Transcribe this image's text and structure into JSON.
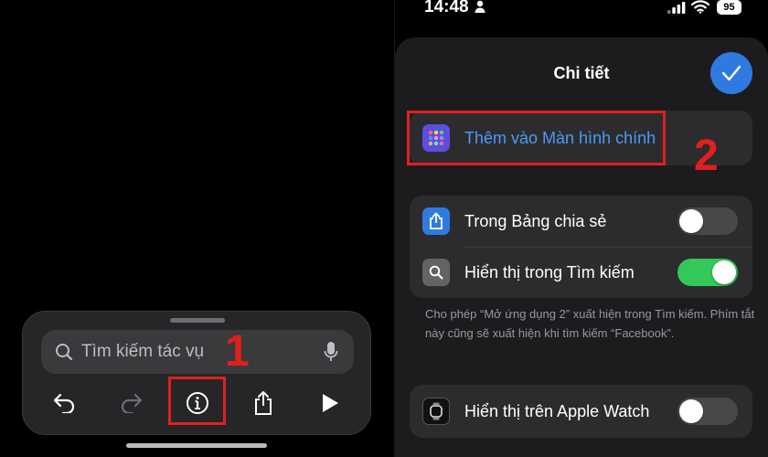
{
  "left": {
    "search": {
      "placeholder": "Tìm kiếm tác vụ"
    },
    "toolbar": {
      "buttons": [
        "undo-icon",
        "redo-icon",
        "info-icon",
        "share-icon",
        "play-icon"
      ]
    },
    "annotation": {
      "step": "1",
      "color": "#e02020"
    }
  },
  "right": {
    "status": {
      "time": "14:48",
      "battery": "95"
    },
    "sheet": {
      "title": "Chi tiết",
      "done_icon": "checkmark-icon",
      "add_home": {
        "label": "Thêm vào Màn hình chính"
      },
      "share_sheet": {
        "label": "Trong Bảng chia sẻ",
        "enabled": false
      },
      "show_search": {
        "label": "Hiển thị trong Tìm kiếm",
        "enabled": true
      },
      "footnote": "Cho phép “Mở ứng dụng 2” xuất hiện trong Tìm kiếm. Phím tắt này cũng sẽ xuất hiện khi tìm kiếm “Facebook”.",
      "apple_watch": {
        "label": "Hiển thị trên Apple Watch",
        "enabled": false
      }
    },
    "annotation": {
      "step": "2",
      "color": "#e02020"
    }
  },
  "colors": {
    "accent": "#2f7ae0",
    "toggle_on": "#34c759",
    "toggle_off": "#48484a",
    "link_blue": "#4a9af5"
  }
}
